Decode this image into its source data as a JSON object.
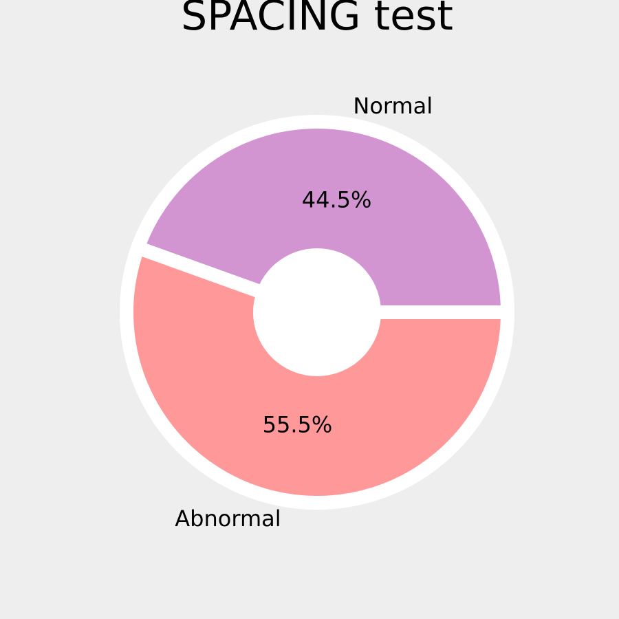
{
  "chart_data": {
    "type": "pie",
    "title": "SPACING test",
    "categories": [
      "Normal",
      "Abnormal"
    ],
    "values": [
      44.5,
      55.5
    ],
    "percent_labels": [
      "44.5%",
      "55.5%"
    ],
    "colors": [
      "#d295d2",
      "#ff9999"
    ],
    "edge_color": "#ffffff",
    "background": "#eeeeee",
    "donut": true,
    "start_angle_deg": 0,
    "direction": "counterclockwise"
  }
}
